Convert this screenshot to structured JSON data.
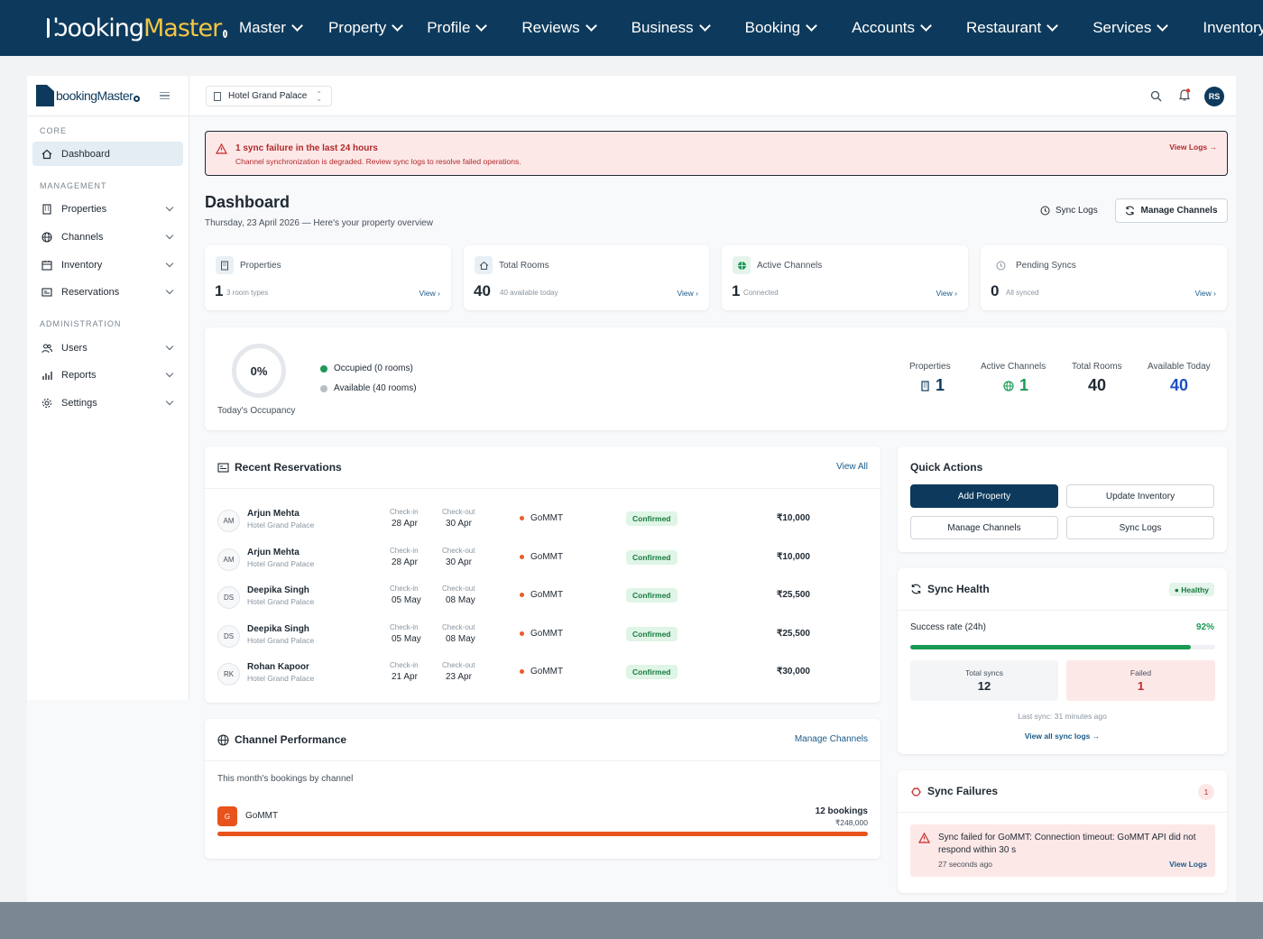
{
  "topnav": {
    "logo_a": "booking",
    "logo_b": "Master",
    "items": [
      "Master",
      "Property",
      "Profile",
      "Reviews",
      "Business",
      "Booking",
      "Accounts",
      "Restaurant",
      "Services",
      "Inventory"
    ]
  },
  "sidebar": {
    "logo": "bookingMaster",
    "sections": {
      "core": "CORE",
      "management": "MANAGEMENT",
      "administration": "ADMINISTRATION"
    },
    "items": [
      {
        "label": "Dashboard",
        "icon": "home-icon"
      },
      {
        "label": "Properties",
        "icon": "building-icon"
      },
      {
        "label": "Channels",
        "icon": "globe-icon"
      },
      {
        "label": "Inventory",
        "icon": "calendar-icon"
      },
      {
        "label": "Reservations",
        "icon": "reservation-icon"
      },
      {
        "label": "Users",
        "icon": "users-icon"
      },
      {
        "label": "Reports",
        "icon": "chart-icon"
      },
      {
        "label": "Settings",
        "icon": "gear-icon"
      }
    ]
  },
  "topbar": {
    "property": "Hotel Grand Palace",
    "avatar": "RS"
  },
  "alert": {
    "title": "1 sync failure in the last 24 hours",
    "message": "Channel synchronization is degraded. Review sync logs to resolve failed operations.",
    "link": "View Logs →"
  },
  "header": {
    "title": "Dashboard",
    "subtitle": "Thursday, 23 April 2026 — Here's your property overview",
    "sync_logs": "Sync Logs",
    "manage_channels": "Manage Channels"
  },
  "stats": [
    {
      "label": "Properties",
      "value": "1",
      "sub": "3 room types",
      "view": "View ›"
    },
    {
      "label": "Total Rooms",
      "value": "40",
      "sub": "40 available today",
      "view": "View ›"
    },
    {
      "label": "Active Channels",
      "value": "1",
      "sub": "Connected",
      "view": "View ›"
    },
    {
      "label": "Pending Syncs",
      "value": "0",
      "sub": "All synced",
      "view": "View ›"
    }
  ],
  "occupancy": {
    "percent": "0%",
    "caption": "Today's Occupancy",
    "occupied": "Occupied (0 rooms)",
    "available": "Available (40 rooms)",
    "occupied_fraction": 0,
    "mini": [
      {
        "label": "Properties",
        "value": "1"
      },
      {
        "label": "Active Channels",
        "value": "1"
      },
      {
        "label": "Total Rooms",
        "value": "40"
      },
      {
        "label": "Available Today",
        "value": "40"
      }
    ]
  },
  "reservations": {
    "title": "Recent Reservations",
    "view_all": "View All",
    "checkin_label": "Check-in",
    "checkout_label": "Check-out",
    "rows": [
      {
        "initials": "AM",
        "name": "Arjun Mehta",
        "hotel": "Hotel Grand Palace",
        "checkin": "28 Apr",
        "checkout": "30 Apr",
        "channel": "GoMMT",
        "status": "Confirmed",
        "amount": "₹10,000"
      },
      {
        "initials": "AM",
        "name": "Arjun Mehta",
        "hotel": "Hotel Grand Palace",
        "checkin": "28 Apr",
        "checkout": "30 Apr",
        "channel": "GoMMT",
        "status": "Confirmed",
        "amount": "₹10,000"
      },
      {
        "initials": "DS",
        "name": "Deepika Singh",
        "hotel": "Hotel Grand Palace",
        "checkin": "05 May",
        "checkout": "08 May",
        "channel": "GoMMT",
        "status": "Confirmed",
        "amount": "₹25,500"
      },
      {
        "initials": "DS",
        "name": "Deepika Singh",
        "hotel": "Hotel Grand Palace",
        "checkin": "05 May",
        "checkout": "08 May",
        "channel": "GoMMT",
        "status": "Confirmed",
        "amount": "₹25,500"
      },
      {
        "initials": "RK",
        "name": "Rohan Kapoor",
        "hotel": "Hotel Grand Palace",
        "checkin": "21 Apr",
        "checkout": "23 Apr",
        "channel": "GoMMT",
        "status": "Confirmed",
        "amount": "₹30,000"
      }
    ]
  },
  "channel_perf": {
    "title": "Channel Performance",
    "link": "Manage Channels",
    "subtitle": "This month's bookings by channel",
    "channel": {
      "letter": "G",
      "name": "GoMMT",
      "bookings": "12 bookings",
      "revenue": "₹248,000",
      "share": 1.0
    }
  },
  "quick_actions": {
    "title": "Quick Actions",
    "buttons": [
      "Add Property",
      "Update Inventory",
      "Manage Channels",
      "Sync Logs"
    ]
  },
  "sync_health": {
    "title": "Sync Health",
    "badge": "● Healthy",
    "rate_label": "Success rate (24h)",
    "rate": "92%",
    "rate_fraction": 0.92,
    "total_label": "Total syncs",
    "total": "12",
    "failed_label": "Failed",
    "failed": "1",
    "last_sync": "Last sync: 31 minutes ago",
    "link": "View all sync logs →"
  },
  "sync_failures": {
    "title": "Sync Failures",
    "count": "1",
    "message": "Sync failed for GoMMT: Connection timeout: GoMMT API did not respond within 30 s",
    "time": "27 seconds ago",
    "link": "View Logs"
  },
  "colors": {
    "navy": "#0d3a5c",
    "success": "#1a9a55",
    "danger": "#c62828",
    "accent": "#f4c542",
    "blue": "#1f4fc4",
    "orange": "#e8531c"
  }
}
